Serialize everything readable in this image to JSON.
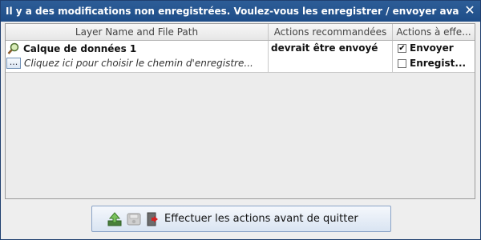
{
  "window": {
    "title": "Il y a des modifications non enregistrées. Voulez-vous les enregistrer / envoyer avant de"
  },
  "table": {
    "headers": [
      "Layer Name and File Path",
      "Actions recommandées",
      "Actions à effe..."
    ],
    "rows": [
      {
        "layer_name": "Calque de données 1",
        "path_button_label": "...",
        "path_placeholder": "Cliquez ici pour choisir le chemin d'enregistre...",
        "recommended_action": "devrait être envoyé",
        "actions": [
          {
            "label": "Envoyer",
            "checked": true
          },
          {
            "label": "Enregist...",
            "checked": false
          }
        ]
      }
    ]
  },
  "bottom": {
    "button_label": "Effectuer les actions avant de quitter"
  },
  "icons": {
    "title_close": "close-icon",
    "layer": "magnifier-icon",
    "upload": "upload-icon",
    "save": "save-icon",
    "exit": "exit-icon"
  }
}
